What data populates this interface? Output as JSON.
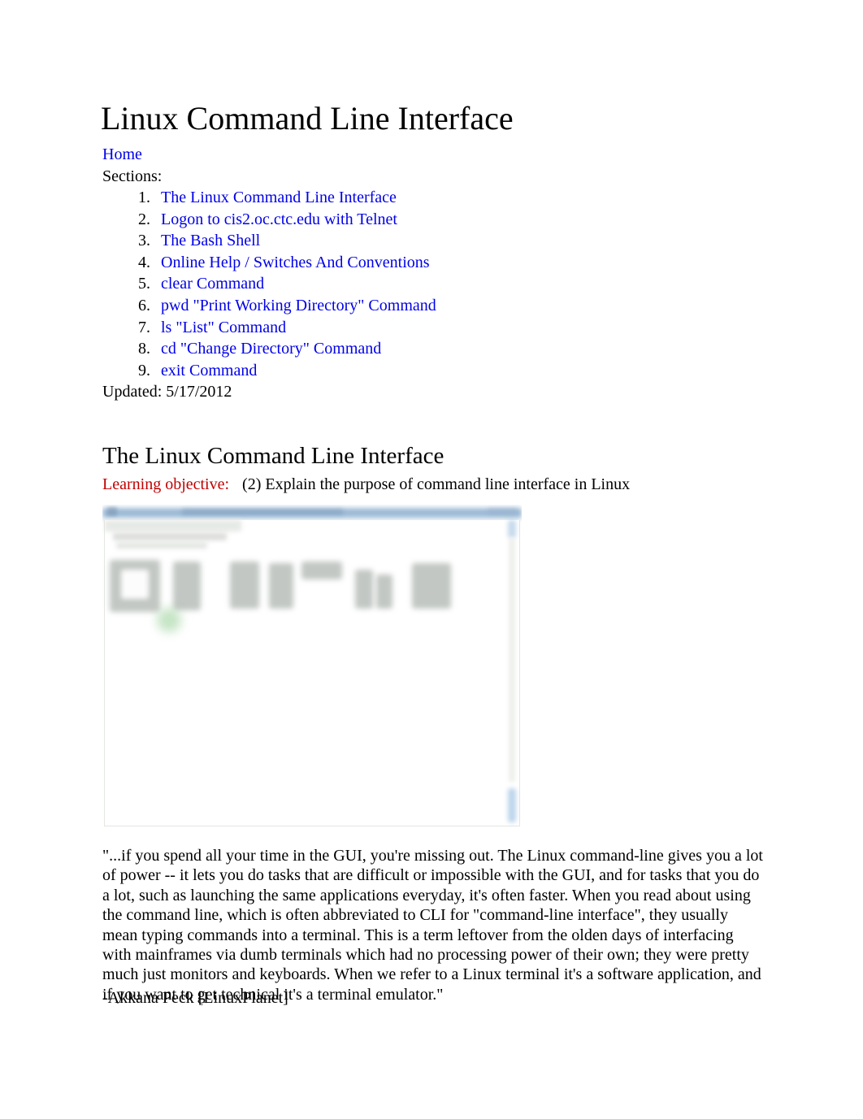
{
  "document": {
    "title": "Linux Command Line Interface",
    "home_link": "Home",
    "sections_label": "Sections:",
    "sections": [
      {
        "n": "1",
        "label": "The Linux Command Line Interface"
      },
      {
        "n": "2",
        "label": "Logon to cis2.oc.ctc.edu with Telnet"
      },
      {
        "n": "3",
        "label": "The Bash Shell"
      },
      {
        "n": "4",
        "label": "Online Help / Switches And Conventions"
      },
      {
        "n": "5",
        "label": "clear Command"
      },
      {
        "n": "6",
        "label": "pwd \"Print Working Directory\" Command"
      },
      {
        "n": "7",
        "label": "ls \"List\" Command"
      },
      {
        "n": "8",
        "label": "cd \"Change Directory\" Command"
      },
      {
        "n": "9",
        "label": "exit Command"
      }
    ],
    "updated": "Updated: 5/17/2012"
  },
  "section": {
    "heading": "The Linux Command Line Interface",
    "objective_label": "Learning objective:",
    "objective_text": "(2) Explain the purpose of command line interface in Linux"
  },
  "figure": {
    "alt": "blurred screenshot of an application window with blue title bar"
  },
  "quote": {
    "body": "\"...if you spend all your time in the GUI, you're missing out. The Linux command-line gives you a lot of power -- it lets you do tasks that are difficult or impossible with the GUI, and for tasks that you do a lot, such as launching the same applications everyday, it's often faster. When you read about using the command line, which is often abbreviated to CLI for \"command-line interface\", they usually mean typing commands into a terminal. This is a term leftover from the olden days of interfacing with mainframes via dumb terminals which had no processing power of their own; they were pretty much just monitors and keyboards. When we refer to a Linux terminal it's a software application, and if you want to get technical it's a terminal emulator.\"",
    "attribution": "-Akkana Peck [LinuxPlanet]"
  },
  "colors": {
    "link_blue": "#0000e8",
    "objective_red": "#c00000",
    "text_black": "#000000",
    "page_background": "#ffffff",
    "titlebar_blue": "#7ea3c8"
  }
}
